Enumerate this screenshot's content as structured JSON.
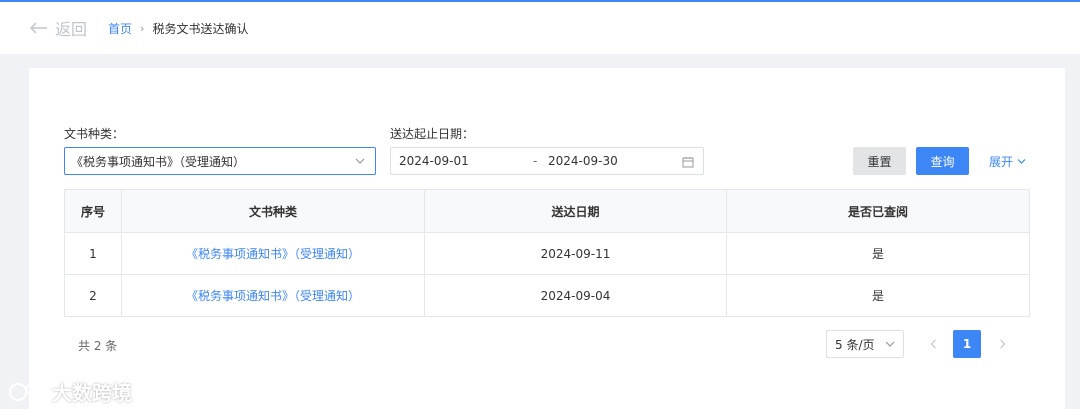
{
  "colors": {
    "accent": "#3d86f5",
    "page_bg": "#f1f2f5",
    "card_bg": "#ffffff"
  },
  "header": {
    "back_label": "返回",
    "breadcrumb": {
      "home": "首页",
      "current": "税务文书送达确认"
    }
  },
  "filters": {
    "doc_type_label": "文书种类：",
    "doc_type_value": "《税务事项通知书》（受理通知）",
    "date_label": "送达起止日期：",
    "date_start": "2024-09-01",
    "date_separator": "-",
    "date_end": "2024-09-30",
    "reset_label": "重置",
    "query_label": "查询",
    "expand_label": "展开"
  },
  "table": {
    "headers": [
      "序号",
      "文书种类",
      "送达日期",
      "是否已查阅"
    ],
    "rows": [
      {
        "index": "1",
        "doc_type": "《税务事项通知书》（受理通知）",
        "date": "2024-09-11",
        "viewed": "是"
      },
      {
        "index": "2",
        "doc_type": "《税务事项通知书》（受理通知）",
        "date": "2024-09-04",
        "viewed": "是"
      }
    ]
  },
  "pagination": {
    "total_text": "共 2 条",
    "page_size": "5 条/页",
    "current_page": "1"
  },
  "watermark": {
    "text": "大数跨境"
  },
  "icons": {
    "back": "arrow-left-icon",
    "breadcrumb_separator": "chevron-right-icon",
    "select_caret": "chevron-down-icon",
    "calendar": "calendar-icon",
    "expand": "chevron-down-icon",
    "prev": "chevron-left-icon",
    "next": "chevron-right-icon"
  }
}
